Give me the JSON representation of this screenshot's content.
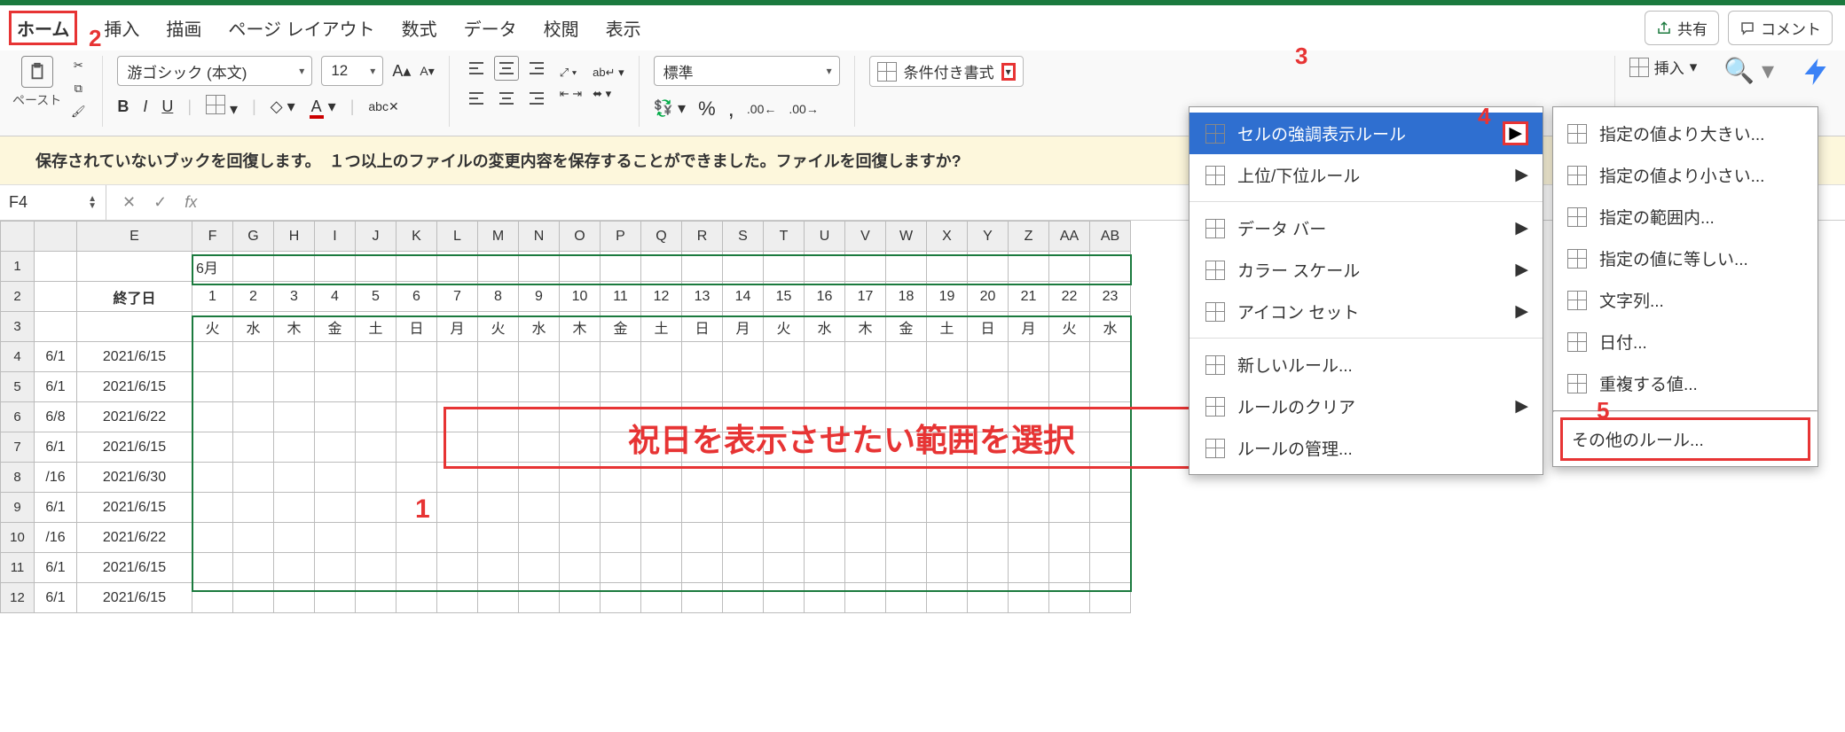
{
  "tabs": {
    "home": "ホーム",
    "insert": "挿入",
    "draw": "描画",
    "page_layout": "ページ レイアウト",
    "formulas": "数式",
    "data": "データ",
    "review": "校閲",
    "view": "表示"
  },
  "share": {
    "label": "共有"
  },
  "comment": {
    "label": "コメント"
  },
  "paste": {
    "label": "ペースト"
  },
  "font": {
    "name": "游ゴシック (本文)",
    "size": "12",
    "bold": "B",
    "italic": "I",
    "underline": "U"
  },
  "number": {
    "format": "標準"
  },
  "cond_format": {
    "label": "条件付き書式"
  },
  "ribbon_insert": {
    "label": "挿入"
  },
  "recovery": {
    "text": "保存されていないブックを回復します。　１つ以上のファイルの変更内容を保存することができました。ファイルを回復しますか?"
  },
  "name_box": {
    "value": "F4"
  },
  "fx": {
    "x": "✕",
    "check": "✓",
    "label": "fx"
  },
  "col_headers": [
    "E",
    "F",
    "G",
    "H",
    "I",
    "J",
    "K",
    "L",
    "M",
    "N",
    "O",
    "P",
    "Q",
    "R",
    "S",
    "T",
    "U",
    "V",
    "W",
    "X",
    "Y",
    "Z",
    "AA",
    "AB"
  ],
  "row_headers": [
    "1",
    "2",
    "3",
    "4",
    "5",
    "6",
    "7",
    "8",
    "9",
    "10",
    "11",
    "12"
  ],
  "header_row": {
    "end_date": "終了日",
    "month": "6月"
  },
  "days": [
    "1",
    "2",
    "3",
    "4",
    "5",
    "6",
    "7",
    "8",
    "9",
    "10",
    "11",
    "12",
    "13",
    "14",
    "15",
    "16",
    "17",
    "18",
    "19",
    "20",
    "21",
    "22",
    "23"
  ],
  "weekdays": [
    "火",
    "水",
    "木",
    "金",
    "土",
    "日",
    "月",
    "火",
    "水",
    "木",
    "金",
    "土",
    "日",
    "月",
    "火",
    "水",
    "木",
    "金",
    "土",
    "日",
    "月",
    "火",
    "水"
  ],
  "rows_data": [
    {
      "d": "6/1",
      "e": "2021/6/15"
    },
    {
      "d": "6/1",
      "e": "2021/6/15"
    },
    {
      "d": "6/8",
      "e": "2021/6/22"
    },
    {
      "d": "6/1",
      "e": "2021/6/15"
    },
    {
      "d": "/16",
      "e": "2021/6/30"
    },
    {
      "d": "6/1",
      "e": "2021/6/15"
    },
    {
      "d": "/16",
      "e": "2021/6/22"
    },
    {
      "d": "6/1",
      "e": "2021/6/15"
    },
    {
      "d": "6/1",
      "e": "2021/6/15"
    }
  ],
  "cf_menu": {
    "highlight": "セルの強調表示ルール",
    "top_bottom": "上位/下位ルール",
    "data_bars": "データ バー",
    "color_scales": "カラー スケール",
    "icon_sets": "アイコン セット",
    "new_rule": "新しいルール...",
    "clear": "ルールのクリア",
    "manage": "ルールの管理..."
  },
  "hl_menu": {
    "greater": "指定の値より大きい...",
    "less": "指定の値より小さい...",
    "between": "指定の範囲内...",
    "equal": "指定の値に等しい...",
    "text": "文字列...",
    "date": "日付...",
    "dup": "重複する値...",
    "more": "その他のルール..."
  },
  "annotations": {
    "n1": "1",
    "n2": "2",
    "n3": "3",
    "n4": "4",
    "n5": "5",
    "text1": "祝日を表示させたい範囲を選択"
  }
}
